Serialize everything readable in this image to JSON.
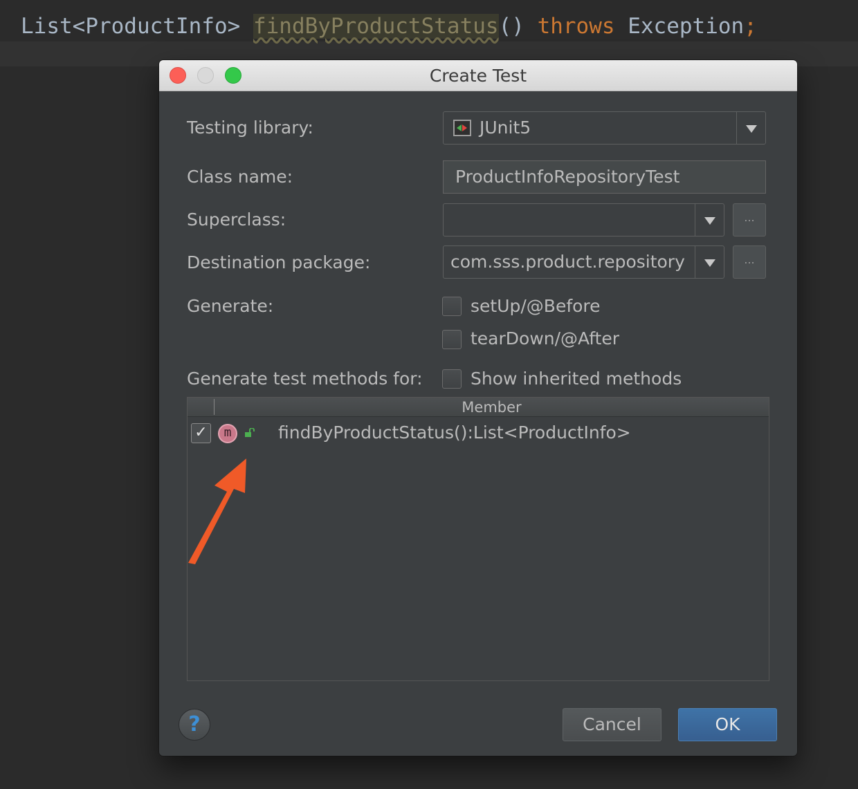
{
  "editor": {
    "code_type": "List<ProductInfo> ",
    "code_method": "findByProductStatus",
    "code_parens": "() ",
    "code_throws": "throws",
    "code_exception": " Exception",
    "code_semicolon": ";"
  },
  "dialog": {
    "title": "Create Test",
    "testing_library_label": "Testing library:",
    "testing_library_value": "JUnit5",
    "class_name_label": "Class name:",
    "class_name_value": "ProductInfoRepositoryTest",
    "superclass_label": "Superclass:",
    "superclass_value": "",
    "destination_label": "Destination package:",
    "destination_value": "com.sss.product.repository",
    "browse_label": "...",
    "generate_label": "Generate:",
    "setup_label": "setUp/@Before",
    "setup_checked": false,
    "teardown_label": "tearDown/@After",
    "teardown_checked": false,
    "methods_for_label": "Generate test methods for:",
    "show_inherited_label": "Show inherited methods",
    "show_inherited_checked": false,
    "table": {
      "header": "Member",
      "rows": [
        {
          "checked": true,
          "check_glyph": "✓",
          "icon": "method-icon",
          "icon_glyph": "m",
          "visibility_icon": "public-lock-icon",
          "text": "findByProductStatus():List<ProductInfo>"
        }
      ]
    },
    "help_glyph": "?",
    "cancel_label": "Cancel",
    "ok_label": "OK"
  },
  "colors": {
    "editor_bg": "#2b2b2b",
    "dialog_bg": "#3c3f41",
    "keyword": "#cc7832",
    "ok_button": "#3d6fa3",
    "annotation_arrow": "#f05a28"
  }
}
